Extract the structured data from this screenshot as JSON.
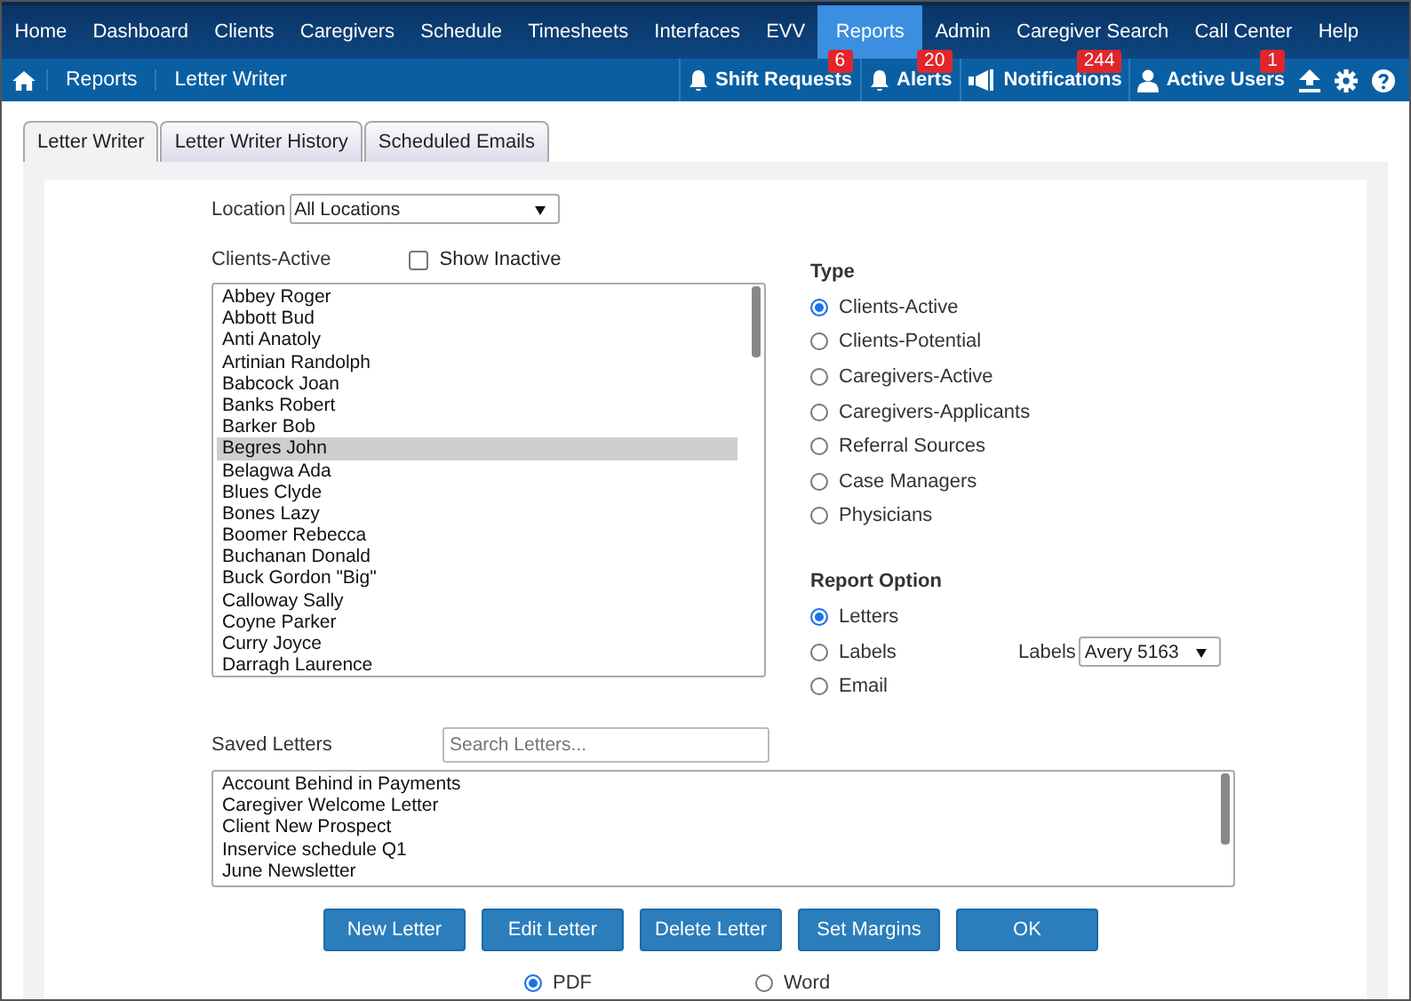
{
  "nav": [
    {
      "label": "Home",
      "selected": false
    },
    {
      "label": "Dashboard",
      "selected": false
    },
    {
      "label": "Clients",
      "selected": false
    },
    {
      "label": "Caregivers",
      "selected": false
    },
    {
      "label": "Schedule",
      "selected": false
    },
    {
      "label": "Timesheets",
      "selected": false
    },
    {
      "label": "Interfaces",
      "selected": false
    },
    {
      "label": "EVV",
      "selected": false
    },
    {
      "label": "Reports",
      "selected": true
    },
    {
      "label": "Admin",
      "selected": false
    },
    {
      "label": "Caregiver Search",
      "selected": false
    },
    {
      "label": "Call Center",
      "selected": false
    },
    {
      "label": "Help",
      "selected": false
    }
  ],
  "breadcrumbs": [
    "Reports",
    "Letter Writer"
  ],
  "toolbar": [
    {
      "kind": "bell",
      "label": "Shift Requests",
      "badge": "6"
    },
    {
      "kind": "bell",
      "label": "Alerts",
      "badge": "20"
    },
    {
      "kind": "megaphone",
      "label": "Notifications",
      "badge": "244"
    },
    {
      "kind": "user",
      "label": "Active Users",
      "badge": "1"
    }
  ],
  "tabs": [
    {
      "label": "Letter Writer",
      "selected": true
    },
    {
      "label": "Letter Writer History",
      "selected": false
    },
    {
      "label": "Scheduled Emails",
      "selected": false
    }
  ],
  "location": {
    "label": "Location",
    "value": "All Locations"
  },
  "clients": {
    "label": "Clients-Active",
    "show_inactive": {
      "label": "Show Inactive",
      "checked": false
    },
    "items": [
      {
        "name": "Abbey Roger",
        "selected": false
      },
      {
        "name": "Abbott Bud",
        "selected": false
      },
      {
        "name": "Anti Anatoly",
        "selected": false
      },
      {
        "name": "Artinian Randolph",
        "selected": false
      },
      {
        "name": "Babcock Joan",
        "selected": false
      },
      {
        "name": "Banks Robert",
        "selected": false
      },
      {
        "name": "Barker Bob",
        "selected": false
      },
      {
        "name": "Begres John",
        "selected": true
      },
      {
        "name": "Belagwa Ada",
        "selected": false
      },
      {
        "name": "Blues Clyde",
        "selected": false
      },
      {
        "name": "Bones Lazy",
        "selected": false
      },
      {
        "name": "Boomer Rebecca",
        "selected": false
      },
      {
        "name": "Buchanan Donald",
        "selected": false
      },
      {
        "name": "Buck Gordon \"Big\"",
        "selected": false
      },
      {
        "name": "Calloway Sally",
        "selected": false
      },
      {
        "name": "Coyne Parker",
        "selected": false
      },
      {
        "name": "Curry Joyce",
        "selected": false
      },
      {
        "name": "Darragh Laurence",
        "selected": false
      }
    ]
  },
  "type": {
    "label": "Type",
    "options": [
      {
        "label": "Clients-Active",
        "selected": true
      },
      {
        "label": "Clients-Potential",
        "selected": false
      },
      {
        "label": "Caregivers-Active",
        "selected": false
      },
      {
        "label": "Caregivers-Applicants",
        "selected": false
      },
      {
        "label": "Referral Sources",
        "selected": false
      },
      {
        "label": "Case Managers",
        "selected": false
      },
      {
        "label": "Physicians",
        "selected": false
      }
    ]
  },
  "report_option": {
    "label": "Report Option",
    "options": [
      {
        "label": "Letters",
        "selected": true
      },
      {
        "label": "Labels",
        "selected": false
      },
      {
        "label": "Email",
        "selected": false
      }
    ],
    "labels_select": {
      "label": "Labels",
      "value": "Avery 5163"
    }
  },
  "saved_letters": {
    "label": "Saved Letters",
    "search_placeholder": "Search Letters...",
    "items": [
      "Account Behind in Payments",
      "Caregiver Welcome Letter",
      "Client New Prospect",
      "Inservice schedule Q1",
      "June Newsletter"
    ]
  },
  "buttons": [
    "New Letter",
    "Edit Letter",
    "Delete Letter",
    "Set Margins",
    "OK"
  ],
  "format": [
    {
      "label": "PDF",
      "selected": true
    },
    {
      "label": "Word",
      "selected": false
    }
  ]
}
